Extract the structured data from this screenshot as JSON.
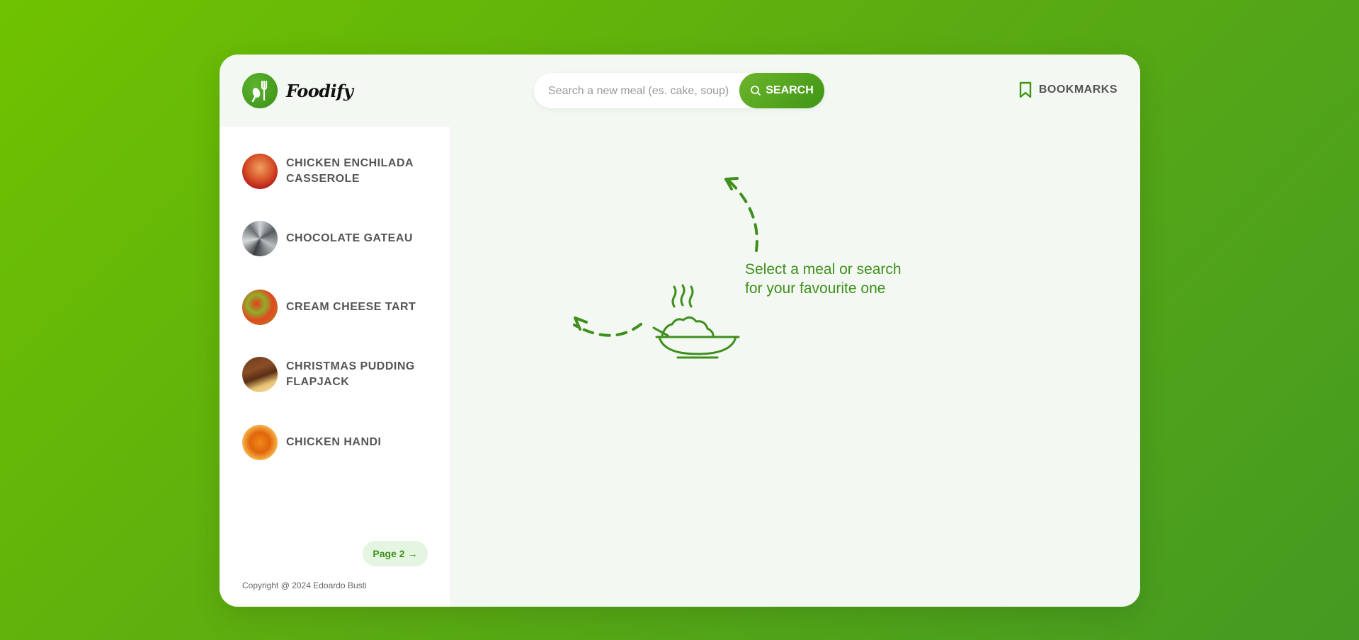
{
  "app": {
    "name": "Foodify"
  },
  "search": {
    "placeholder": "Search a new meal (es. cake, soup)",
    "button_label": "SEARCH"
  },
  "header": {
    "bookmarks_label": "BOOKMARKS"
  },
  "results": [
    {
      "title": "CHICKEN ENCHILADA CASSEROLE"
    },
    {
      "title": "CHOCOLATE GATEAU"
    },
    {
      "title": "CREAM CHEESE TART"
    },
    {
      "title": "CHRISTMAS PUDDING FLAPJACK"
    },
    {
      "title": "CHICKEN HANDI"
    }
  ],
  "pagination": {
    "next_label": "Page 2"
  },
  "footer": {
    "copyright": "Copyright @ 2024 Edoardo Busti"
  },
  "main": {
    "message_line1": "Select a meal or search",
    "message_line2": "for your favourite one"
  },
  "colors": {
    "accent": "#3f8f1d",
    "brand_gradient_start": "#6fc200",
    "brand_gradient_end": "#449a22"
  }
}
